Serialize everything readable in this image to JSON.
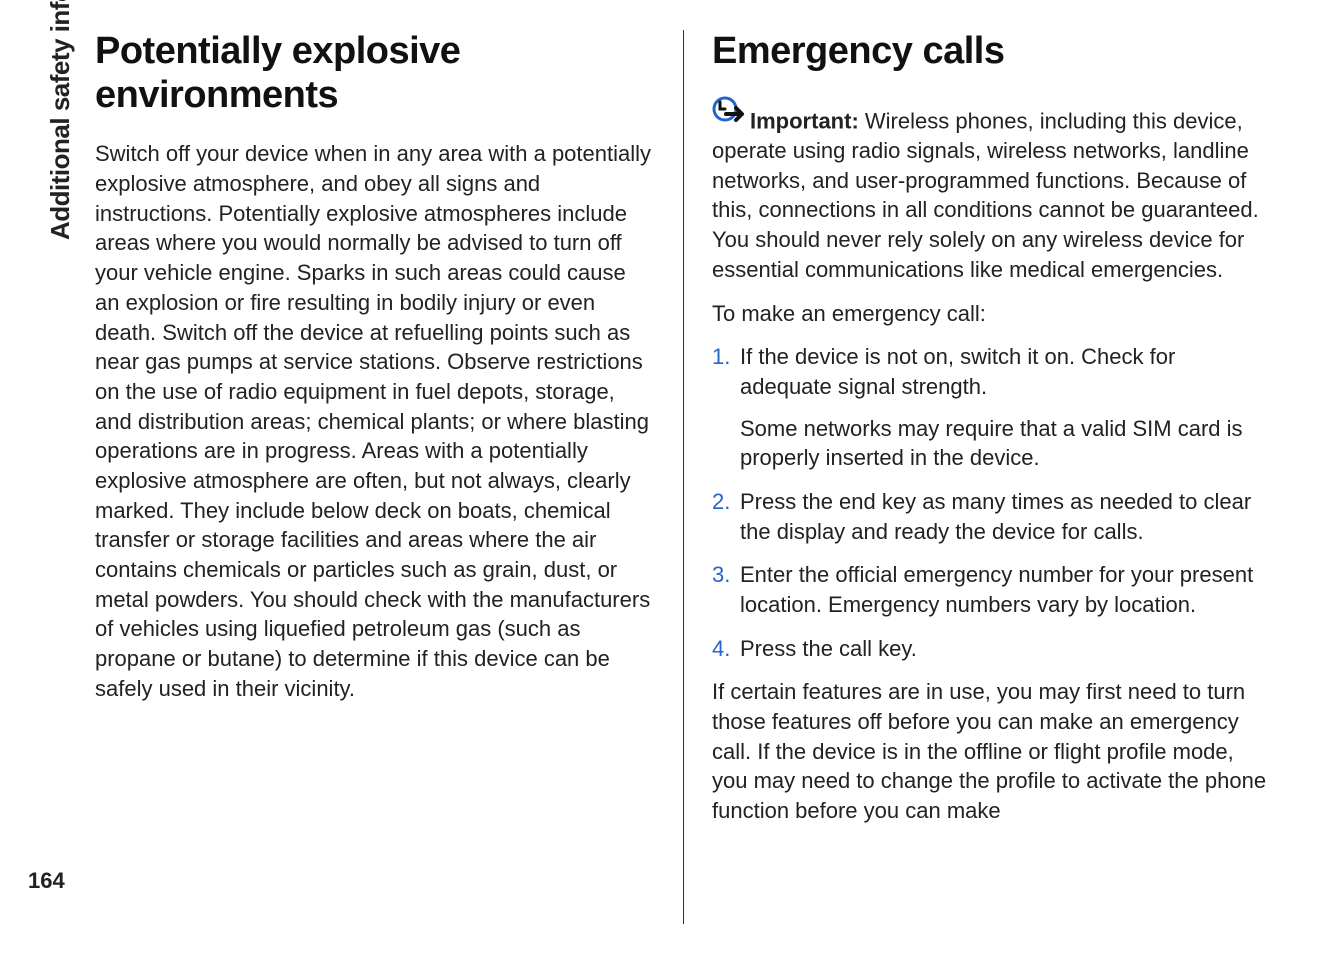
{
  "sidebar": {
    "section_label": "Additional safety information"
  },
  "page_number": "164",
  "left_column": {
    "heading": "Potentially explosive environments",
    "paragraph": "Switch off your device when in any area with a potentially explosive atmosphere, and obey all signs and instructions. Potentially explosive atmospheres include areas where you would normally be advised to turn off your vehicle engine. Sparks in such areas could cause an explosion or fire resulting in bodily injury or even death. Switch off the device at refuelling points such as near gas pumps at service stations. Observe restrictions on the use of radio equipment in fuel depots, storage, and distribution areas; chemical plants; or where blasting operations are in progress. Areas with a potentially explosive atmosphere are often, but not always, clearly marked. They include below deck on boats, chemical transfer or storage facilities and areas where the air contains chemicals or particles such as grain, dust, or metal powders. You should check with the manufacturers of vehicles using liquefied petroleum gas (such as propane or butane) to determine if this device can be safely used in their vicinity."
  },
  "right_column": {
    "heading": "Emergency calls",
    "important_label": "Important:",
    "important_text": "  Wireless phones, including this device, operate using radio signals, wireless networks, landline networks, and user-programmed functions. Because of this, connections in all conditions cannot be guaranteed. You should never rely solely on any wireless device for essential communications like medical emergencies.",
    "intro": "To make an emergency call:",
    "steps": [
      {
        "num": "1.",
        "text": "If the device is not on, switch it on. Check for adequate signal strength.",
        "note": "Some networks may require that a valid SIM card is properly inserted in the device."
      },
      {
        "num": "2.",
        "text": "Press the end key as many times as needed to clear the display and ready the device for calls."
      },
      {
        "num": "3.",
        "text": "Enter the official emergency number for your present location. Emergency numbers vary by location."
      },
      {
        "num": "4.",
        "text": "Press the call key."
      }
    ],
    "closing": "If certain features are in use, you may first need to turn those features off before you can make an emergency call. If the device is in the offline or flight profile mode, you may need to change the profile to activate the phone function before you can make"
  }
}
